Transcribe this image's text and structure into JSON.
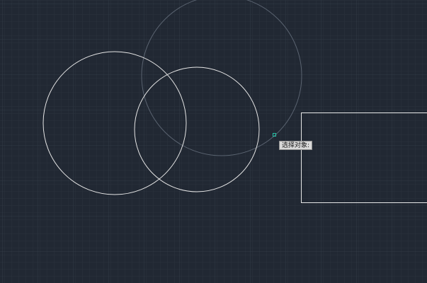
{
  "canvas": {
    "background_color": "#212833",
    "grid_minor_color": "#2a323d",
    "grid_major_color": "#313a46",
    "entity_color": "#e6e6e6",
    "preview_color": "#5f6874",
    "cursor_color": "#25c0a6"
  },
  "entities": [
    {
      "type": "circle",
      "label": "circle"
    },
    {
      "type": "circle",
      "label": "circle"
    },
    {
      "type": "circle",
      "label": "preview-circle"
    },
    {
      "type": "rectangle",
      "label": "rectangle"
    }
  ],
  "cursor": {
    "icon": "pickbox-icon",
    "tooltip": "选择对象:"
  }
}
